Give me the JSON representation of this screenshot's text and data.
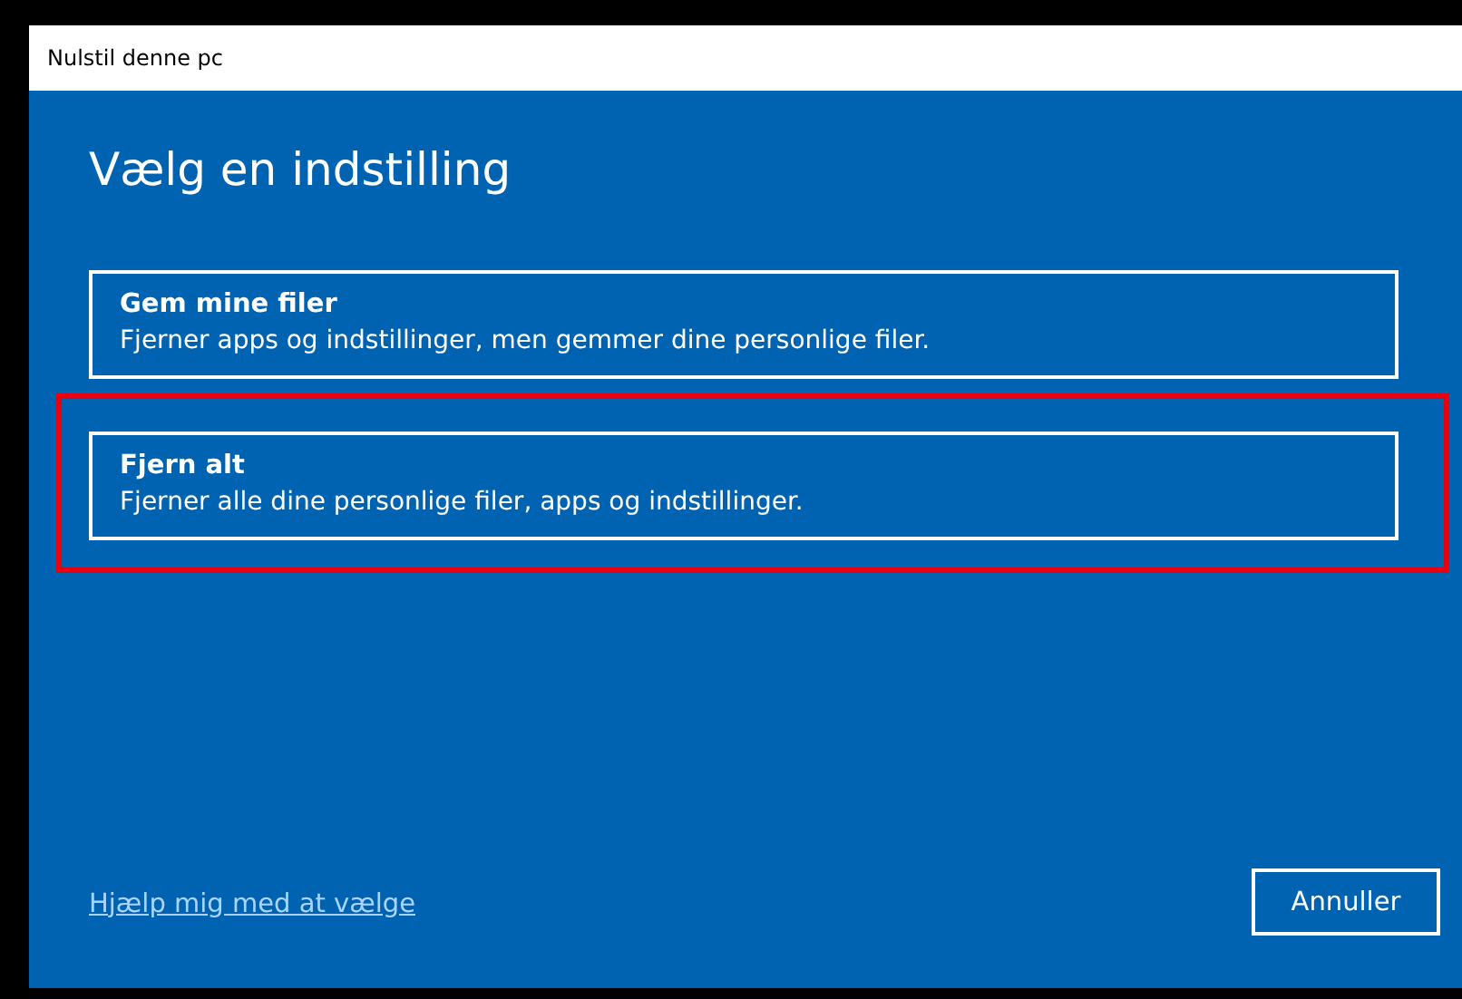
{
  "window": {
    "title": "Nulstil denne pc"
  },
  "heading": "Vælg en indstilling",
  "options": [
    {
      "title": "Gem mine filer",
      "description": "Fjerner apps og indstillinger, men gemmer dine personlige filer.",
      "highlighted": false
    },
    {
      "title": "Fjern alt",
      "description": "Fjerner alle dine personlige filer, apps og indstillinger.",
      "highlighted": true
    }
  ],
  "help_link": "Hjælp mig med at vælge",
  "buttons": [
    "Annuller"
  ]
}
